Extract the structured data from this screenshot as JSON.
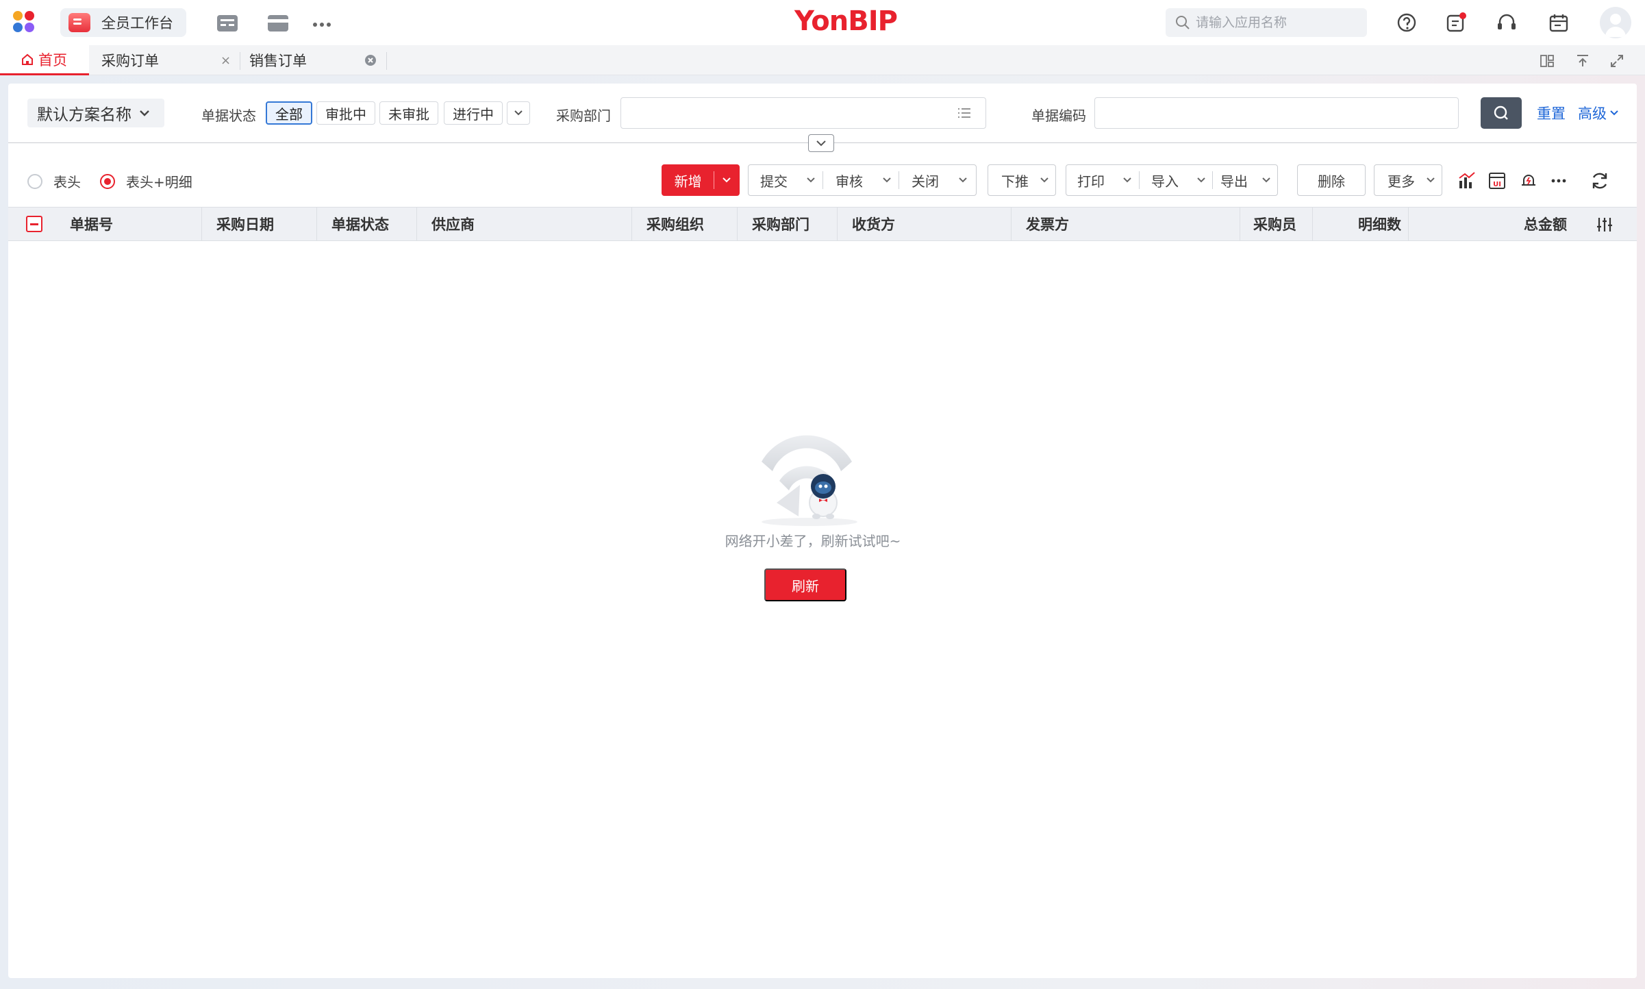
{
  "colors": {
    "brand": "#e8222e",
    "link": "#1f67d8",
    "active_filter": "#3478d6",
    "search_button": "#4b5563"
  },
  "topbar": {
    "workbench_label": "全员工作台",
    "brand": "YonBIP",
    "search_placeholder": "请输入应用名称",
    "icons": [
      "app-grid-icon",
      "table-icon",
      "card-icon",
      "more-icon",
      "help-icon",
      "message-icon",
      "headset-icon",
      "calendar-icon",
      "avatar"
    ]
  },
  "tabs": [
    {
      "label": "首页",
      "active": true
    },
    {
      "label": "采购订单",
      "close": "×"
    },
    {
      "label": "销售订单"
    }
  ],
  "filters": {
    "scheme": "默认方案名称",
    "status_label": "单据状态",
    "status_options": [
      "全部",
      "审批中",
      "未审批",
      "进行中"
    ],
    "status_selected": "全部",
    "dept_label": "采购部门",
    "code_label": "单据编码",
    "reset": "重置",
    "advanced": "高级"
  },
  "view": {
    "header_only": "表头",
    "header_detail": "表头+明细",
    "selected": "表头+明细"
  },
  "toolbar": {
    "add": "新增",
    "submit": "提交",
    "audit": "审核",
    "close": "关闭",
    "push": "下推",
    "print": "打印",
    "import": "导入",
    "export": "导出",
    "delete": "删除",
    "more": "更多"
  },
  "table": {
    "columns": [
      "单据号",
      "采购日期",
      "单据状态",
      "供应商",
      "采购组织",
      "采购部门",
      "收货方",
      "发票方",
      "采购员",
      "明细数",
      "总金额"
    ]
  },
  "empty": {
    "message": "网络开小差了，刷新试试吧~",
    "refresh": "刷新"
  }
}
